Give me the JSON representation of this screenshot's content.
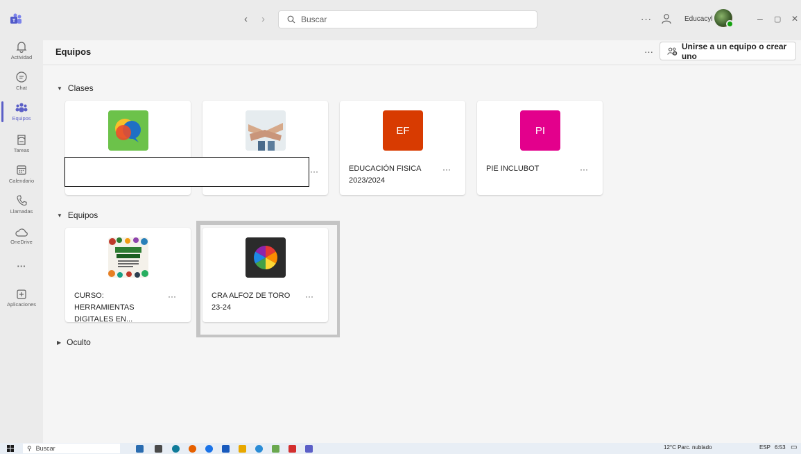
{
  "titlebar": {
    "search_placeholder": "Buscar",
    "more": "···",
    "org_name": "Educacyl",
    "minimize": "–",
    "restore": "▢",
    "close": "✕"
  },
  "rail": {
    "items": [
      {
        "label": "Actividad",
        "icon": "bell-icon"
      },
      {
        "label": "Chat",
        "icon": "chat-icon"
      },
      {
        "label": "Equipos",
        "icon": "teams-icon"
      },
      {
        "label": "Tareas",
        "icon": "assignments-icon"
      },
      {
        "label": "Calendario",
        "icon": "calendar-icon"
      },
      {
        "label": "Llamadas",
        "icon": "phone-icon"
      },
      {
        "label": "OneDrive",
        "icon": "cloud-icon"
      },
      {
        "label": "···",
        "icon": "more-icon"
      },
      {
        "label": "Aplicaciones",
        "icon": "add-apps-icon"
      }
    ]
  },
  "header": {
    "title": "Equipos",
    "more": "···",
    "join_label": "Unirse a un equipo o crear uno"
  },
  "sections": {
    "clases": "Clases",
    "equipos": "Equipos",
    "oculto": "Oculto"
  },
  "clases_cards": [
    {
      "name": "",
      "thumb": "speech-bubbles-image"
    },
    {
      "name": "",
      "thumb": "stacked-hands-image"
    },
    {
      "name": "EDUCACIÓN FISICA 2023/2024",
      "initials": "EF",
      "color": "#d83b01"
    },
    {
      "name": "PIE INCLUBOT",
      "initials": "PI",
      "color": "#e3008c"
    }
  ],
  "equipos_cards": [
    {
      "name": "CURSO: HERRAMIENTAS DIGITALES EN...",
      "thumb": "herramientas-digitales-image"
    },
    {
      "name": "CRA ALFOZ DE TORO 23-24",
      "thumb": "color-wheel-image"
    }
  ],
  "card_more": "···",
  "taskbar": {
    "search_label": "Buscar",
    "weather": "12°C  Parc. nublado",
    "lang": "ESP",
    "time": "6:53"
  }
}
